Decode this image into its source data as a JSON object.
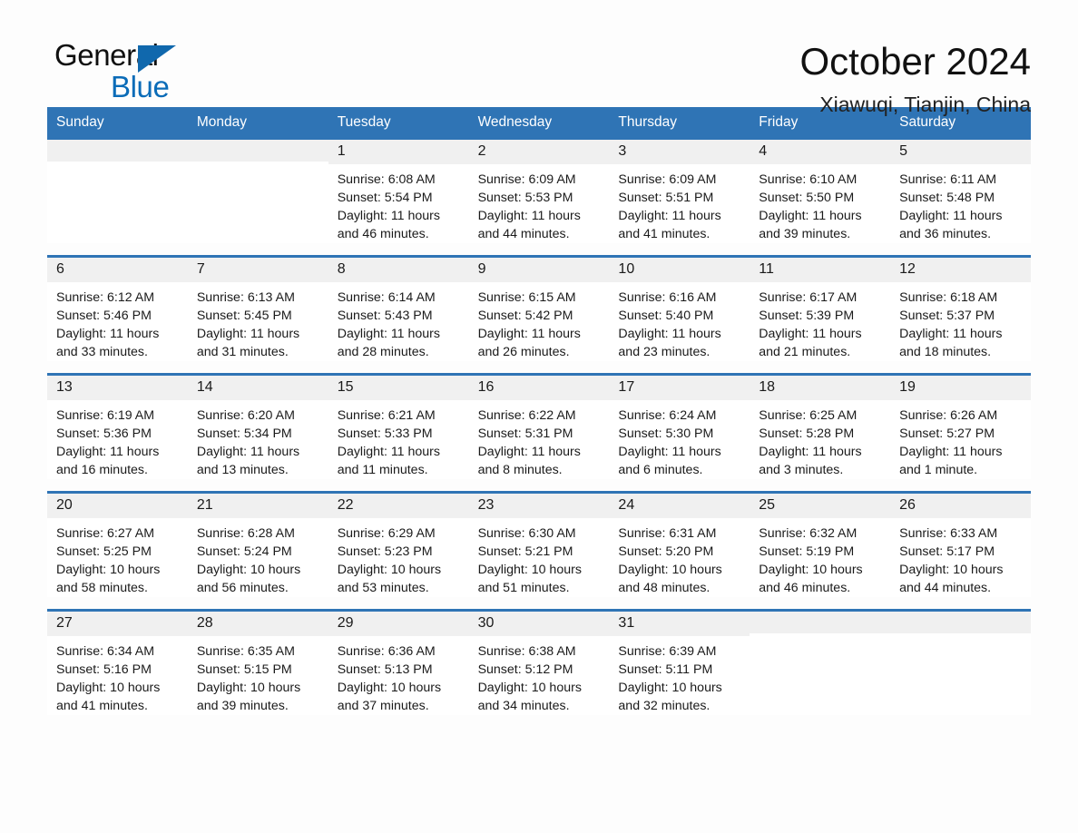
{
  "logo": {
    "word1": "General",
    "word2": "Blue",
    "triangle_color": "#1068ad",
    "blue_color": "#0b6cb8"
  },
  "header": {
    "title": "October 2024",
    "subtitle": "Xiawuqi, Tianjin, China"
  },
  "theme": {
    "header_blue": "#2f74b5",
    "daynum_band": "#f0f0f0",
    "page_bg": "#fdfdfd"
  },
  "weekdays": [
    "Sunday",
    "Monday",
    "Tuesday",
    "Wednesday",
    "Thursday",
    "Friday",
    "Saturday"
  ],
  "weeks": [
    [
      {
        "day": "",
        "sunrise": "",
        "sunset": "",
        "daylight": "",
        "empty": true
      },
      {
        "day": "",
        "sunrise": "",
        "sunset": "",
        "daylight": "",
        "empty": true
      },
      {
        "day": "1",
        "sunrise": "Sunrise: 6:08 AM",
        "sunset": "Sunset: 5:54 PM",
        "daylight": "Daylight: 11 hours and 46 minutes."
      },
      {
        "day": "2",
        "sunrise": "Sunrise: 6:09 AM",
        "sunset": "Sunset: 5:53 PM",
        "daylight": "Daylight: 11 hours and 44 minutes."
      },
      {
        "day": "3",
        "sunrise": "Sunrise: 6:09 AM",
        "sunset": "Sunset: 5:51 PM",
        "daylight": "Daylight: 11 hours and 41 minutes."
      },
      {
        "day": "4",
        "sunrise": "Sunrise: 6:10 AM",
        "sunset": "Sunset: 5:50 PM",
        "daylight": "Daylight: 11 hours and 39 minutes."
      },
      {
        "day": "5",
        "sunrise": "Sunrise: 6:11 AM",
        "sunset": "Sunset: 5:48 PM",
        "daylight": "Daylight: 11 hours and 36 minutes."
      }
    ],
    [
      {
        "day": "6",
        "sunrise": "Sunrise: 6:12 AM",
        "sunset": "Sunset: 5:46 PM",
        "daylight": "Daylight: 11 hours and 33 minutes."
      },
      {
        "day": "7",
        "sunrise": "Sunrise: 6:13 AM",
        "sunset": "Sunset: 5:45 PM",
        "daylight": "Daylight: 11 hours and 31 minutes."
      },
      {
        "day": "8",
        "sunrise": "Sunrise: 6:14 AM",
        "sunset": "Sunset: 5:43 PM",
        "daylight": "Daylight: 11 hours and 28 minutes."
      },
      {
        "day": "9",
        "sunrise": "Sunrise: 6:15 AM",
        "sunset": "Sunset: 5:42 PM",
        "daylight": "Daylight: 11 hours and 26 minutes."
      },
      {
        "day": "10",
        "sunrise": "Sunrise: 6:16 AM",
        "sunset": "Sunset: 5:40 PM",
        "daylight": "Daylight: 11 hours and 23 minutes."
      },
      {
        "day": "11",
        "sunrise": "Sunrise: 6:17 AM",
        "sunset": "Sunset: 5:39 PM",
        "daylight": "Daylight: 11 hours and 21 minutes."
      },
      {
        "day": "12",
        "sunrise": "Sunrise: 6:18 AM",
        "sunset": "Sunset: 5:37 PM",
        "daylight": "Daylight: 11 hours and 18 minutes."
      }
    ],
    [
      {
        "day": "13",
        "sunrise": "Sunrise: 6:19 AM",
        "sunset": "Sunset: 5:36 PM",
        "daylight": "Daylight: 11 hours and 16 minutes."
      },
      {
        "day": "14",
        "sunrise": "Sunrise: 6:20 AM",
        "sunset": "Sunset: 5:34 PM",
        "daylight": "Daylight: 11 hours and 13 minutes."
      },
      {
        "day": "15",
        "sunrise": "Sunrise: 6:21 AM",
        "sunset": "Sunset: 5:33 PM",
        "daylight": "Daylight: 11 hours and 11 minutes."
      },
      {
        "day": "16",
        "sunrise": "Sunrise: 6:22 AM",
        "sunset": "Sunset: 5:31 PM",
        "daylight": "Daylight: 11 hours and 8 minutes."
      },
      {
        "day": "17",
        "sunrise": "Sunrise: 6:24 AM",
        "sunset": "Sunset: 5:30 PM",
        "daylight": "Daylight: 11 hours and 6 minutes."
      },
      {
        "day": "18",
        "sunrise": "Sunrise: 6:25 AM",
        "sunset": "Sunset: 5:28 PM",
        "daylight": "Daylight: 11 hours and 3 minutes."
      },
      {
        "day": "19",
        "sunrise": "Sunrise: 6:26 AM",
        "sunset": "Sunset: 5:27 PM",
        "daylight": "Daylight: 11 hours and 1 minute."
      }
    ],
    [
      {
        "day": "20",
        "sunrise": "Sunrise: 6:27 AM",
        "sunset": "Sunset: 5:25 PM",
        "daylight": "Daylight: 10 hours and 58 minutes."
      },
      {
        "day": "21",
        "sunrise": "Sunrise: 6:28 AM",
        "sunset": "Sunset: 5:24 PM",
        "daylight": "Daylight: 10 hours and 56 minutes."
      },
      {
        "day": "22",
        "sunrise": "Sunrise: 6:29 AM",
        "sunset": "Sunset: 5:23 PM",
        "daylight": "Daylight: 10 hours and 53 minutes."
      },
      {
        "day": "23",
        "sunrise": "Sunrise: 6:30 AM",
        "sunset": "Sunset: 5:21 PM",
        "daylight": "Daylight: 10 hours and 51 minutes."
      },
      {
        "day": "24",
        "sunrise": "Sunrise: 6:31 AM",
        "sunset": "Sunset: 5:20 PM",
        "daylight": "Daylight: 10 hours and 48 minutes."
      },
      {
        "day": "25",
        "sunrise": "Sunrise: 6:32 AM",
        "sunset": "Sunset: 5:19 PM",
        "daylight": "Daylight: 10 hours and 46 minutes."
      },
      {
        "day": "26",
        "sunrise": "Sunrise: 6:33 AM",
        "sunset": "Sunset: 5:17 PM",
        "daylight": "Daylight: 10 hours and 44 minutes."
      }
    ],
    [
      {
        "day": "27",
        "sunrise": "Sunrise: 6:34 AM",
        "sunset": "Sunset: 5:16 PM",
        "daylight": "Daylight: 10 hours and 41 minutes."
      },
      {
        "day": "28",
        "sunrise": "Sunrise: 6:35 AM",
        "sunset": "Sunset: 5:15 PM",
        "daylight": "Daylight: 10 hours and 39 minutes."
      },
      {
        "day": "29",
        "sunrise": "Sunrise: 6:36 AM",
        "sunset": "Sunset: 5:13 PM",
        "daylight": "Daylight: 10 hours and 37 minutes."
      },
      {
        "day": "30",
        "sunrise": "Sunrise: 6:38 AM",
        "sunset": "Sunset: 5:12 PM",
        "daylight": "Daylight: 10 hours and 34 minutes."
      },
      {
        "day": "31",
        "sunrise": "Sunrise: 6:39 AM",
        "sunset": "Sunset: 5:11 PM",
        "daylight": "Daylight: 10 hours and 32 minutes."
      },
      {
        "day": "",
        "sunrise": "",
        "sunset": "",
        "daylight": "",
        "empty": true
      },
      {
        "day": "",
        "sunrise": "",
        "sunset": "",
        "daylight": "",
        "empty": true
      }
    ]
  ]
}
